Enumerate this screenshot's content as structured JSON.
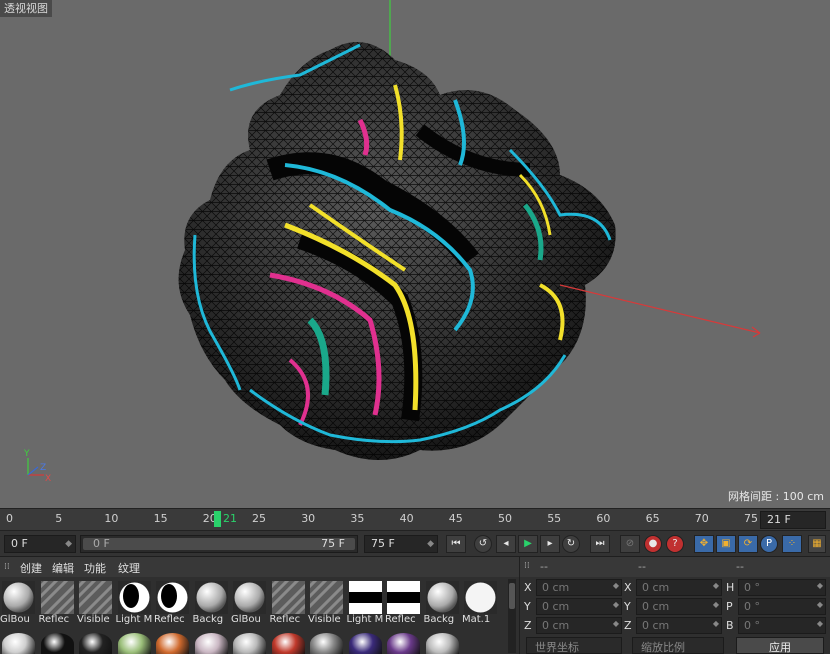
{
  "viewport": {
    "title": "透视视图",
    "grid_info": "网格间距 : 100 cm",
    "axis_y": "Y",
    "axis_z": "Z",
    "axis_x": "X"
  },
  "timeline": {
    "ticks": [
      "0",
      "5",
      "10",
      "15",
      "20",
      "25",
      "30",
      "35",
      "40",
      "45",
      "50",
      "55",
      "60",
      "65",
      "70",
      "75"
    ],
    "current_frame": "21",
    "frame_field": "21 F"
  },
  "transport": {
    "start_field": "0 F",
    "range_start": "0 F",
    "range_end": "75 F",
    "end_field": "75 F",
    "buttons": [
      "skip-start",
      "prev-key",
      "prev-frame",
      "play",
      "next-frame",
      "next-key",
      "skip-end"
    ]
  },
  "materials": {
    "menu": [
      "创建",
      "编辑",
      "功能",
      "纹理"
    ],
    "items": [
      {
        "name": "GlBou",
        "kind": "sphere-white"
      },
      {
        "name": "Reflec",
        "kind": "hatch"
      },
      {
        "name": "Visible",
        "kind": "hatch"
      },
      {
        "name": "Light M",
        "kind": "sphere-black-white"
      },
      {
        "name": "Reflec",
        "kind": "sphere-black-white"
      },
      {
        "name": "Backg",
        "kind": "sphere-white"
      },
      {
        "name": "GlBou",
        "kind": "sphere-white"
      },
      {
        "name": "Reflec",
        "kind": "hatch"
      },
      {
        "name": "Visible",
        "kind": "hatch"
      },
      {
        "name": "Light M",
        "kind": "stripe"
      },
      {
        "name": "Reflec",
        "kind": "stripe"
      },
      {
        "name": "Backg",
        "kind": "sphere-white"
      },
      {
        "name": "Mat.1",
        "kind": "sphere-pure-white"
      }
    ],
    "second_row_colors": [
      "#cfcfcf",
      "#111111",
      "#222222",
      "#9bbf7a",
      "#d06a2e",
      "#c9b6c2",
      "#b9b9b9",
      "#c0392b",
      "#888888",
      "#3a2a7a",
      "#6a3a8a",
      "#bbbbbb"
    ]
  },
  "coords": {
    "header": [
      "--",
      "--",
      "--"
    ],
    "rows": [
      {
        "l1": "X",
        "v1": "0 cm",
        "l2": "X",
        "v2": "0 cm",
        "l3": "H",
        "v3": "0 °"
      },
      {
        "l1": "Y",
        "v1": "0 cm",
        "l2": "Y",
        "v2": "0 cm",
        "l3": "P",
        "v3": "0 °"
      },
      {
        "l1": "Z",
        "v1": "0 cm",
        "l2": "Z",
        "v2": "0 cm",
        "l3": "B",
        "v3": "0 °"
      }
    ],
    "mode_select": "世界坐标",
    "scale_select": "缩放比例",
    "apply": "应用"
  }
}
